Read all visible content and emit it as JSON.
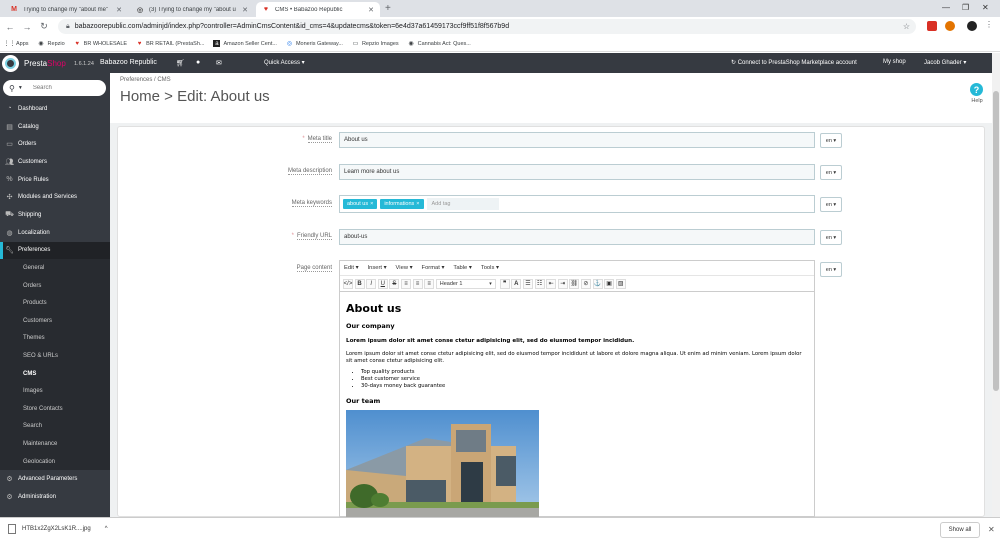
{
  "browser": {
    "tabs": [
      {
        "title": "Trying to change my \"about me\"",
        "favicon": "M"
      },
      {
        "title": "(3) Trying to change my \"about u",
        "favicon": "◎"
      },
      {
        "title": "CMS • Babazoo Republic",
        "favicon": "♥"
      }
    ],
    "url": "babazoorepublic.com/adminjd/index.php?controller=AdminCmsContent&id_cms=4&updatecms&token=6e4d37a61459173ccf9ff51f8f567b9d",
    "bookmarks": [
      "Apps",
      "Repzio",
      "BR WHOLESALE",
      "BR RETAIL (PrestaSh...",
      "Amazon Seller Cent...",
      "Moneris Gateway...",
      "Repzio Images",
      "Cannabis Act: Ques..."
    ]
  },
  "header": {
    "brand_a": "Presta",
    "brand_b": "Shop",
    "version": "1.6.1.24",
    "shop_name": "Babazoo Republic",
    "quick_access": "Quick Access ▾",
    "connect": "Connect to PrestaShop Marketplace account",
    "my_shop": "My shop",
    "user": "Jacob Ghader ▾"
  },
  "sidebar": {
    "search_placeholder": "Search",
    "items": [
      {
        "label": "Dashboard",
        "icon": "dashboard-icon"
      },
      {
        "label": "Catalog",
        "icon": "catalog-icon"
      },
      {
        "label": "Orders",
        "icon": "orders-icon"
      },
      {
        "label": "Customers",
        "icon": "customers-icon"
      },
      {
        "label": "Price Rules",
        "icon": "price-rules-icon"
      },
      {
        "label": "Modules and Services",
        "icon": "modules-icon"
      },
      {
        "label": "Shipping",
        "icon": "shipping-icon"
      },
      {
        "label": "Localization",
        "icon": "localization-icon"
      },
      {
        "label": "Preferences",
        "icon": "wrench-icon"
      }
    ],
    "subitems": [
      "General",
      "Orders",
      "Products",
      "Customers",
      "Themes",
      "SEO & URLs",
      "CMS",
      "Images",
      "Store Contacts",
      "Search",
      "Maintenance",
      "Geolocation"
    ],
    "bottom_items": [
      {
        "label": "Advanced Parameters",
        "icon": "cogs-icon"
      },
      {
        "label": "Administration",
        "icon": "gear-icon"
      }
    ]
  },
  "page": {
    "breadcrumb": "Preferences  /  CMS",
    "title": "Home > Edit: About us",
    "help_label": "Help"
  },
  "form": {
    "meta_title_label": "Meta title",
    "meta_title_value": "About us",
    "meta_description_label": "Meta description",
    "meta_description_value": "Learn more about us",
    "meta_keywords_label": "Meta keywords",
    "keywords": [
      "about us",
      "informations"
    ],
    "add_tag_placeholder": "Add tag",
    "friendly_url_label": "Friendly URL",
    "friendly_url_value": "about-us",
    "page_content_label": "Page content",
    "lang": "en ▾"
  },
  "editor": {
    "menus": [
      "Edit ▾",
      "Insert ▾",
      "View ▾",
      "Format ▾",
      "Table ▾",
      "Tools ▾"
    ],
    "block_format": "Header 1",
    "content": {
      "h1": "About us",
      "h3_company": "Our company",
      "lead": "Lorem ipsum dolor sit amet conse ctetur adipisicing elit, sed do eiusmod tempor incididun.",
      "paragraph": "Lorem ipsum dolor sit amet conse ctetur adipisicing elit, sed do eiusmod tempor incididunt ut labore et dolore magna aliqua. Ut enim ad minim veniam. Lorem ipsum dolor sit amet conse ctetur adipisicing elit.",
      "bullets": [
        "Top quality products",
        "Best customer service",
        "30-days money back guarantee"
      ],
      "h3_team": "Our team"
    }
  },
  "downloads": {
    "file": "HTB1x2ZgX2LsK1R....jpg",
    "show_all": "Show all"
  }
}
